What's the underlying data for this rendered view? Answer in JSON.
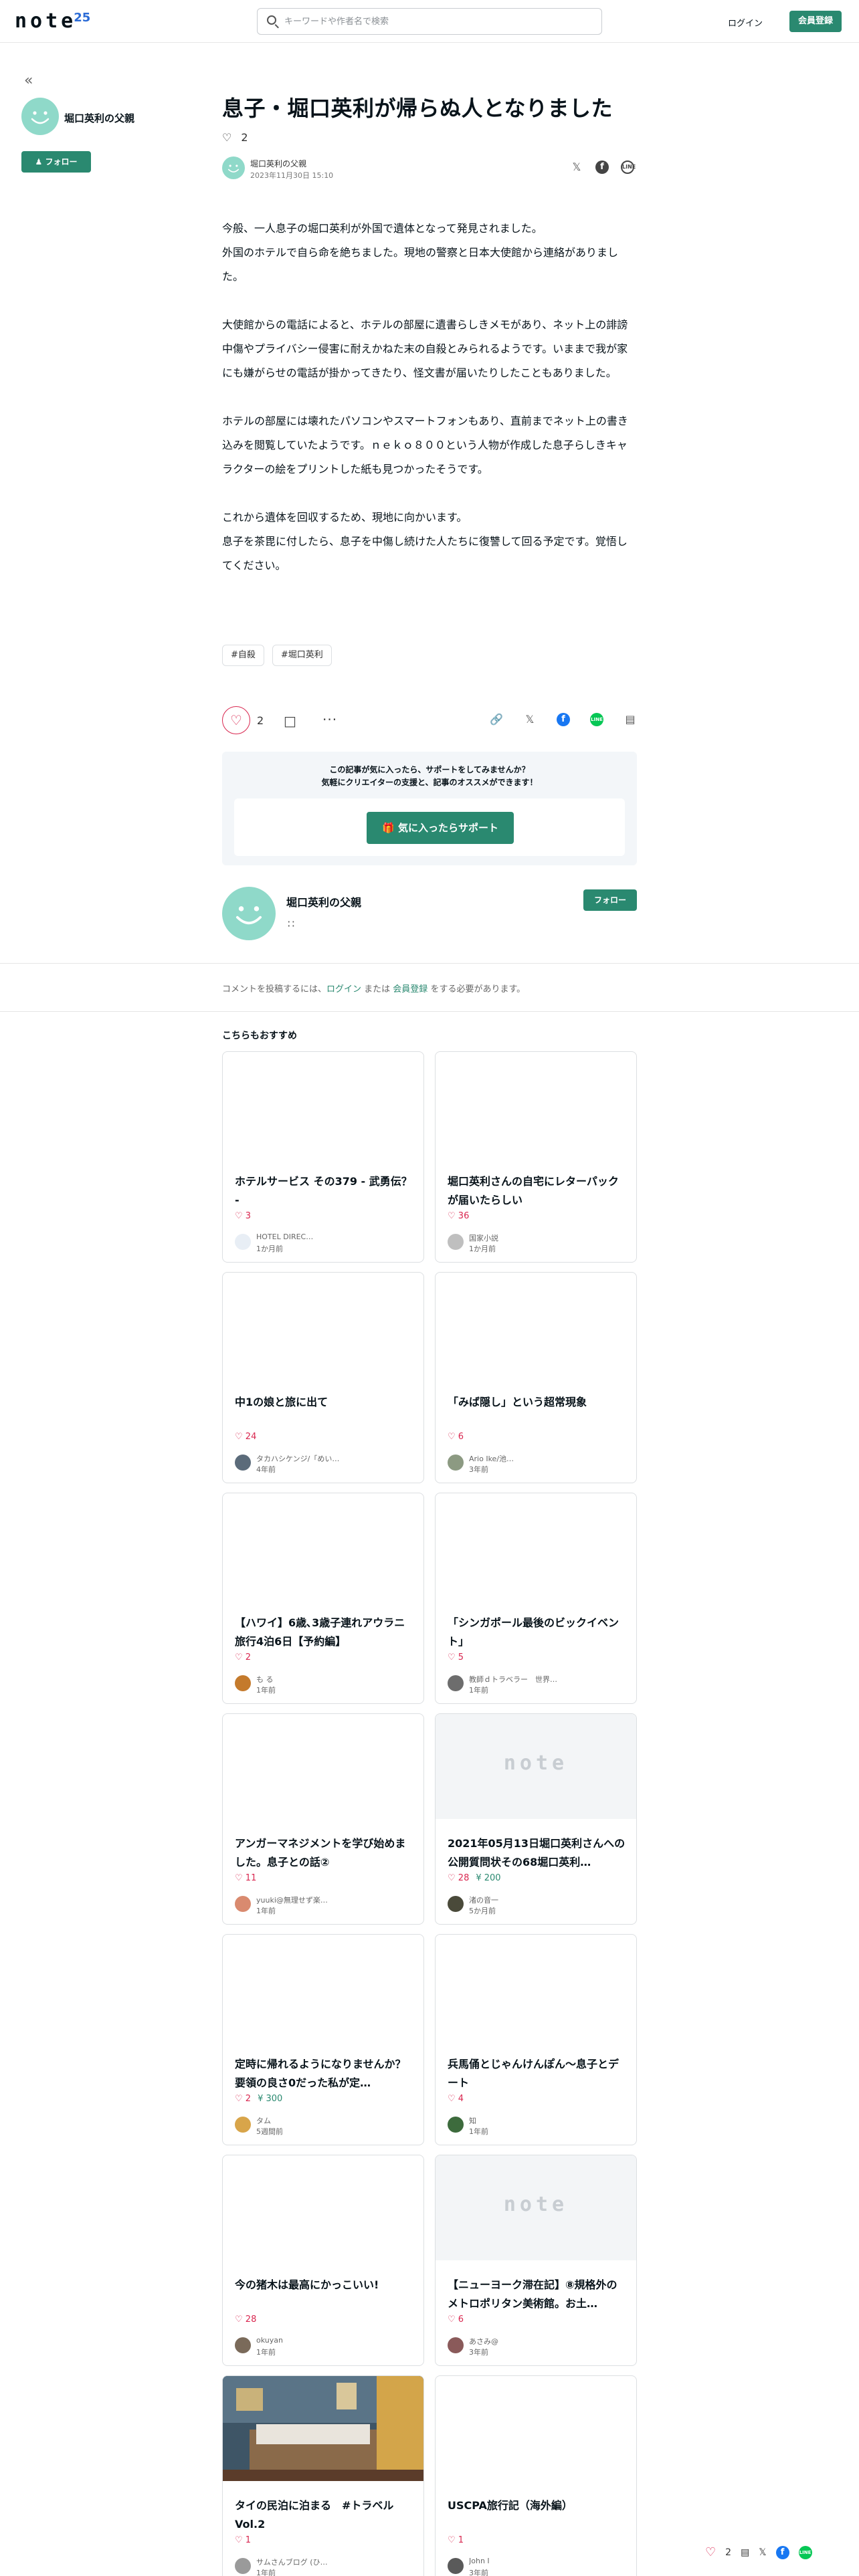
{
  "header": {
    "logo": "note",
    "logo_badge": "25",
    "search_placeholder": "キーワードや作者名で検索",
    "login": "ログイン",
    "signup": "会員登録"
  },
  "sidebar": {
    "collapse": "«",
    "author": "堀口英利の父親",
    "follow": "フォロー"
  },
  "article": {
    "title": "息子・堀口英利が帰らぬ人となりました",
    "likes": "2",
    "author": "堀口英利の父親",
    "date": "2023年11月30日 15:10",
    "paragraphs": [
      "今般、一人息子の堀口英利が外国で遺体となって発見されました。\n外国のホテルで自ら命を絶ちました。現地の警察と日本大使館から連絡がありました。",
      "大使館からの電話によると、ホテルの部屋に遺書らしきメモがあり、ネット上の誹謗中傷やプライバシー侵害に耐えかねた末の自殺とみられるようです。いままで我が家にも嫌がらせの電話が掛かってきたり、怪文書が届いたりしたこともありました。",
      "ホテルの部屋には壊れたパソコンやスマートフォンもあり、直前までネット上の書き込みを閲覧していたようです。ｎｅｋｏ８００という人物が作成した息子らしきキャラクターの絵をプリントした紙も見つかったそうです。",
      "これから遺体を回収するため、現地に向かいます。\n息子を茶毘に付したら、息子を中傷し続けた人たちに復讐して回る予定です。覚悟してください。"
    ],
    "tags": [
      "#自殺",
      "#堀口英利"
    ],
    "like_count": "2"
  },
  "support": {
    "line1": "この記事が気に入ったら、サポートをしてみませんか？",
    "line2": "気軽にクリエイターの支援と、記事のオススメができます！",
    "button": "気に入ったらサポート"
  },
  "author_card": {
    "name": "堀口英利の父親",
    "follow": "フォロー"
  },
  "comment": {
    "prefix": "コメントを投稿するには、",
    "login": "ログイン",
    "or": " または ",
    "signup": "会員登録",
    "suffix": " をする必要があります。"
  },
  "recommend": {
    "title": "こちらもおすすめ",
    "cards": [
      {
        "title": "ホテルサービス その379 - 武勇伝？ -",
        "likes": "3",
        "yen": "",
        "author": "HOTEL DIREC…",
        "time": "1か月前",
        "thumb": "blank",
        "avatar_color": "#e8eef5"
      },
      {
        "title": "堀口英利さんの自宅にレターパックが届いたらしい",
        "likes": "36",
        "yen": "",
        "author": "国家小説",
        "time": "1か月前",
        "thumb": "blank",
        "avatar_color": "#bfbfbf"
      },
      {
        "title": "中1の娘と旅に出て",
        "likes": "24",
        "yen": "",
        "author": "タカハシケンジ/「めい…",
        "time": "4年前",
        "thumb": "blank",
        "avatar_color": "#5b6b7a"
      },
      {
        "title": "「みば隠し」という超常現象",
        "likes": "6",
        "yen": "",
        "author": "Ario Ike/池…",
        "time": "3年前",
        "thumb": "blank",
        "avatar_color": "#8c9a82"
      },
      {
        "title": "【ハワイ】6歳､3歳子連れアウラニ旅行4泊6日【予約編】",
        "likes": "2",
        "yen": "",
        "author": "も る",
        "time": "1年前",
        "thumb": "blank",
        "avatar_color": "#c47a2c"
      },
      {
        "title": "「シンガポール最後のビックイベント」",
        "likes": "5",
        "yen": "",
        "author": "教師ｄトラベラー　世界…",
        "time": "1年前",
        "thumb": "blank",
        "avatar_color": "#6d6d6d"
      },
      {
        "title": "アンガーマネジメントを学び始めました。息子との話②",
        "likes": "11",
        "yen": "",
        "author": "yuuki@無理せず楽…",
        "time": "1年前",
        "thumb": "blank",
        "avatar_color": "#d98a6f"
      },
      {
        "title": "2021年05月13日堀口英利さんへの公開質問状その68堀口英利…",
        "likes": "28",
        "yen": "200",
        "author": "渚の音一",
        "time": "5か月前",
        "thumb": "note",
        "avatar_color": "#4a4a3a"
      },
      {
        "title": "定時に帰れるようになりませんか？要領の良さ0だった私が定…",
        "likes": "2",
        "yen": "300",
        "author": "タム",
        "time": "5週間前",
        "thumb": "blank",
        "avatar_color": "#d8a54a"
      },
      {
        "title": "兵馬俑とじゃんけんぽん～息子とデート",
        "likes": "4",
        "yen": "",
        "author": "知",
        "time": "1年前",
        "thumb": "blank",
        "avatar_color": "#3d6b3d"
      },
      {
        "title": "今の猪木は最高にかっこいい!",
        "likes": "28",
        "yen": "",
        "author": "okuyan",
        "time": "1年前",
        "thumb": "blank",
        "avatar_color": "#7a6a5a"
      },
      {
        "title": "【ニューヨーク滞在記】⑧規格外のメトロポリタン美術館。お土…",
        "likes": "6",
        "yen": "",
        "author": "あさみ@",
        "time": "3年前",
        "thumb": "note",
        "avatar_color": "#8a5a5a"
      },
      {
        "title": "タイの民泊に泊まる　#トラベル Vol.2",
        "likes": "1",
        "yen": "",
        "author": "サムさんブログ (ひ…",
        "time": "1年前",
        "thumb": "photo",
        "avatar_color": "#9a9a9a"
      },
      {
        "title": "USCPA旅行記（海外編）",
        "likes": "1",
        "yen": "",
        "author": "John I",
        "time": "3年前",
        "thumb": "blank",
        "avatar_color": "#5a5a5a"
      }
    ]
  },
  "floating": {
    "likes": "2"
  },
  "icons": {
    "search": "search-icon",
    "heart": "heart-icon",
    "comment": "comment-icon",
    "more": "more-icon",
    "link": "link-icon",
    "x": "x-icon",
    "facebook": "facebook-icon",
    "line": "line-icon",
    "rss": "rss-icon",
    "gift": "gift-icon"
  },
  "colors": {
    "accent": "#2a8970",
    "like": "#d9264f",
    "avatar": "#8fd9c9",
    "facebook": "#1877f2",
    "line": "#06c755"
  }
}
